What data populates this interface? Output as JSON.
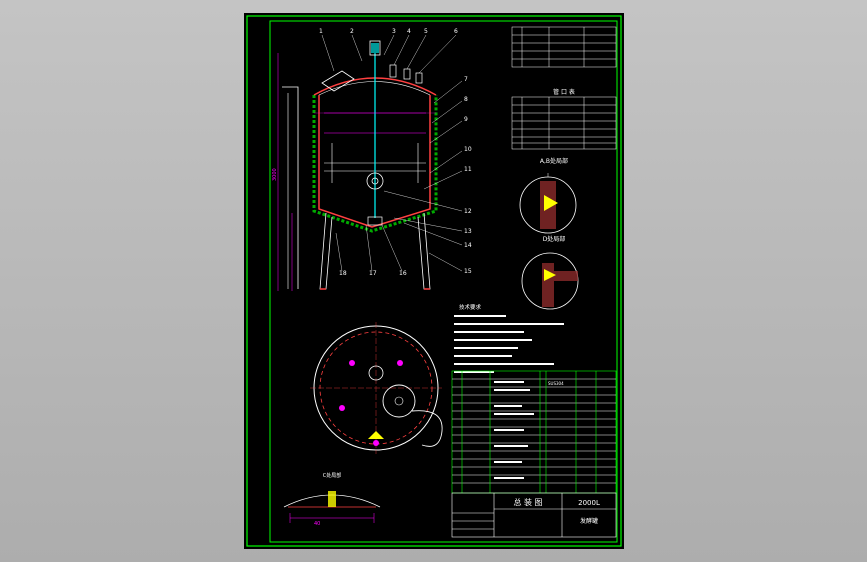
{
  "drawing": {
    "main_title": "总 装 图",
    "volume": "2000L",
    "product_name": "发酵罐",
    "tech_requirements_heading": "技术要求",
    "nozzle_table_heading": "管 口 表",
    "detail_ab_heading": "A,B处局部",
    "detail_d_heading": "D处局部",
    "detail_c_heading": "C处局部",
    "height_dim": "3000",
    "bottom_dim": "40",
    "callouts": [
      "1",
      "2",
      "3",
      "4",
      "5",
      "6",
      "7",
      "8",
      "9",
      "10",
      "11",
      "12",
      "13",
      "14",
      "15",
      "16",
      "17",
      "18"
    ],
    "material_sample": "SUS304"
  },
  "colors": {
    "background": "#b9b9b9",
    "sheet": "#000000",
    "border": "#00ff00",
    "vessel": "#ff4040",
    "lines": "#ffffff",
    "dims": "#ff00ff",
    "accent": "#ffff00",
    "shaft": "#00ffff",
    "insulation": "#00aa00"
  }
}
